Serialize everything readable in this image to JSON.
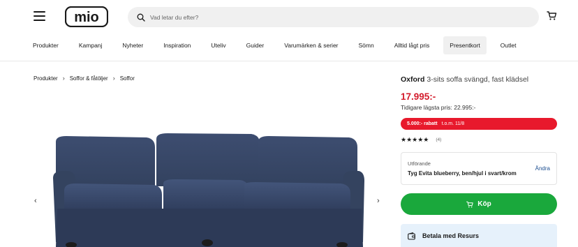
{
  "header": {
    "logo_text": "mio",
    "search_placeholder": "Vad letar du efter?"
  },
  "nav": {
    "items": [
      {
        "label": "Produkter"
      },
      {
        "label": "Kampanj"
      },
      {
        "label": "Nyheter"
      },
      {
        "label": "Inspiration"
      },
      {
        "label": "Uteliv"
      },
      {
        "label": "Guider"
      },
      {
        "label": "Varumärken & serier"
      },
      {
        "label": "Sömn"
      },
      {
        "label": "Alltid lågt pris"
      },
      {
        "label": "Presentkort",
        "active": true
      },
      {
        "label": "Outlet"
      }
    ]
  },
  "breadcrumb": {
    "items": [
      "Produkter",
      "Soffor & fåtöljer",
      "Soffor"
    ],
    "separator": "›"
  },
  "carousel": {
    "prev": "‹",
    "next": "›"
  },
  "product": {
    "brand": "Oxford",
    "description": "3-sits soffa svängd, fast klädsel",
    "price": "17.995:-",
    "previous_price": "Tidigare lägsta pris: 22.995:-",
    "discount_amount": "5.000:- rabatt",
    "discount_until": "t.o.m. 11/8",
    "stars": "★★★★★",
    "rating_value": 4.5,
    "rating_count": "(4)",
    "color": "#3a4a6b"
  },
  "variant": {
    "label": "Utförande",
    "value": "Tyg Evita blueberry, ben/hjul i svart/krom",
    "change_label": "Ändra"
  },
  "buy": {
    "label": "Köp"
  },
  "payment": {
    "title": "Betala med Resurs"
  },
  "colors": {
    "price_red": "#d31c2c",
    "discount_red": "#e8192c",
    "buy_green": "#1aa83c",
    "link_blue": "#1d4f91",
    "payment_bg": "#e6f1fb"
  }
}
